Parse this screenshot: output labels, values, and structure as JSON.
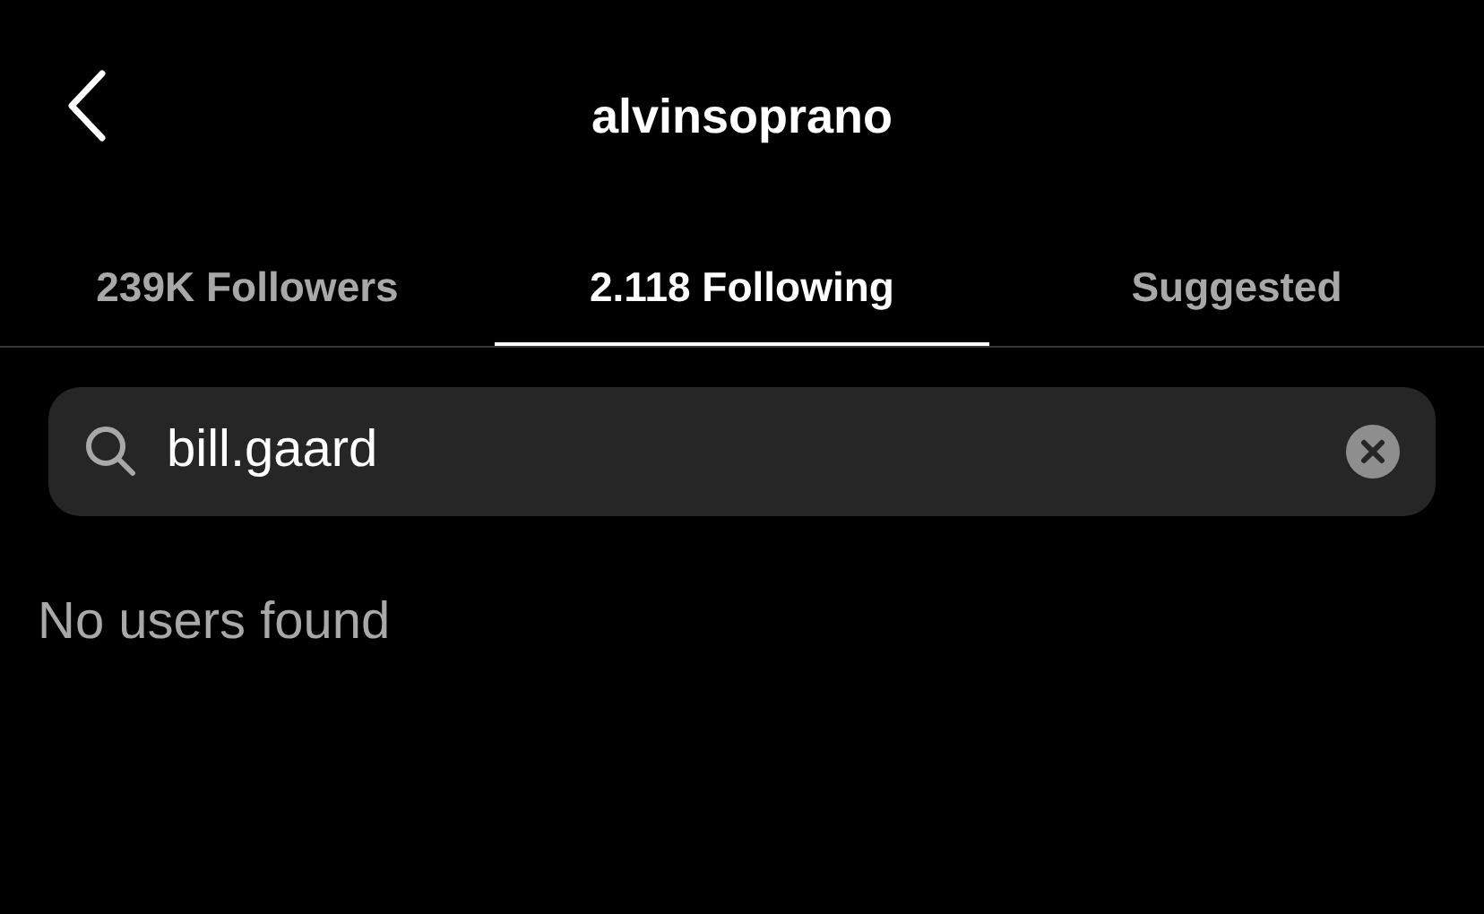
{
  "header": {
    "title": "alvinsoprano"
  },
  "tabs": [
    {
      "label": "239K Followers",
      "selected": false
    },
    {
      "label": "2.118 Following",
      "selected": true
    },
    {
      "label": "Suggested",
      "selected": false
    }
  ],
  "search": {
    "value": "bill.gaard"
  },
  "message": "No users found"
}
